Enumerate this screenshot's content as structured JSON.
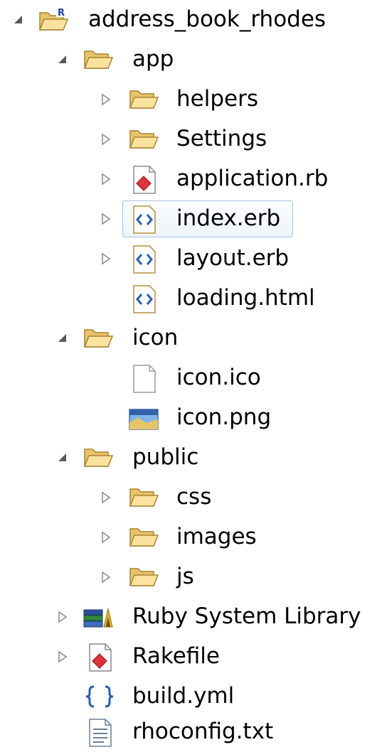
{
  "tree": {
    "items": [
      {
        "label": "address_book_rhodes",
        "level": 0,
        "icon": "project-folder-icon",
        "expand": "expanded"
      },
      {
        "label": "app",
        "level": 1,
        "icon": "folder-icon",
        "expand": "expanded"
      },
      {
        "label": "helpers",
        "level": 2,
        "icon": "folder-icon",
        "expand": "collapsed"
      },
      {
        "label": "Settings",
        "level": 2,
        "icon": "folder-icon",
        "expand": "collapsed"
      },
      {
        "label": "application.rb",
        "level": 2,
        "icon": "ruby-file-icon",
        "expand": "collapsed"
      },
      {
        "label": "index.erb",
        "level": 2,
        "icon": "erb-file-icon",
        "expand": "collapsed",
        "selected": true
      },
      {
        "label": "layout.erb",
        "level": 2,
        "icon": "erb-file-icon",
        "expand": "collapsed"
      },
      {
        "label": "loading.html",
        "level": 2,
        "icon": "erb-file-icon",
        "expand": "none"
      },
      {
        "label": "icon",
        "level": 1,
        "icon": "folder-icon",
        "expand": "expanded"
      },
      {
        "label": "icon.ico",
        "level": 2,
        "icon": "blank-file-icon",
        "expand": "none"
      },
      {
        "label": "icon.png",
        "level": 2,
        "icon": "image-file-icon",
        "expand": "none"
      },
      {
        "label": "public",
        "level": 1,
        "icon": "folder-icon",
        "expand": "expanded"
      },
      {
        "label": "css",
        "level": 2,
        "icon": "folder-icon",
        "expand": "collapsed"
      },
      {
        "label": "images",
        "level": 2,
        "icon": "folder-icon",
        "expand": "collapsed"
      },
      {
        "label": "js",
        "level": 2,
        "icon": "folder-icon",
        "expand": "collapsed"
      },
      {
        "label": "Ruby System Library",
        "level": 1,
        "icon": "library-icon",
        "expand": "collapsed"
      },
      {
        "label": "Rakefile",
        "level": 1,
        "icon": "ruby-file-icon",
        "expand": "collapsed"
      },
      {
        "label": "build.yml",
        "level": 1,
        "icon": "yml-file-icon",
        "expand": "none"
      },
      {
        "label": "rhoconfig.txt",
        "level": 1,
        "icon": "text-file-icon",
        "expand": "none"
      }
    ]
  },
  "colors": {
    "selection_border": "#a7c3e0",
    "folder_fill": "#f7d98a",
    "folder_stroke": "#c29a3b",
    "twisty": "#7a7a7a"
  }
}
